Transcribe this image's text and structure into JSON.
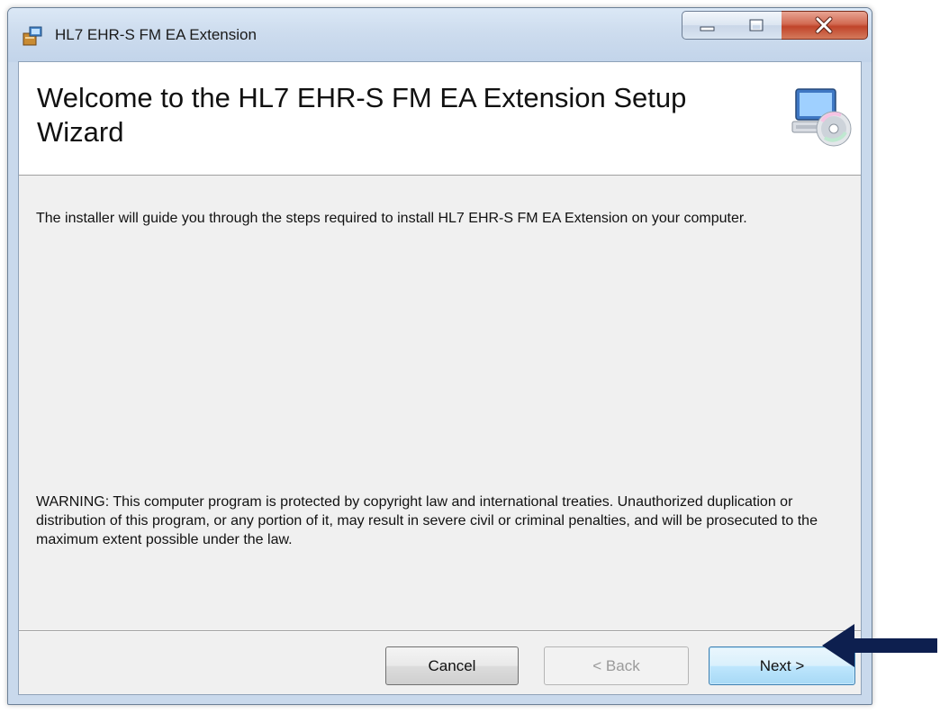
{
  "window": {
    "title": "HL7 EHR-S FM EA Extension",
    "controls": [
      "minimize",
      "maximize",
      "close"
    ]
  },
  "banner": {
    "title": "Welcome to the HL7 EHR-S FM EA Extension Setup Wizard",
    "icon": "computer-with-cd-icon"
  },
  "body": {
    "intro": "The installer will guide you through the steps required to install HL7 EHR-S FM EA Extension on your computer.",
    "warning": "WARNING: This computer program is protected by copyright law and international treaties. Unauthorized duplication or distribution of this program, or any portion of it, may result in severe civil or criminal penalties, and will be prosecuted to the maximum extent possible under the law."
  },
  "buttons": {
    "cancel": "Cancel",
    "back": "< Back",
    "next": "Next >"
  },
  "colors": {
    "annotation_arrow": "#0d1f4f",
    "close_button": "#c7472d"
  }
}
